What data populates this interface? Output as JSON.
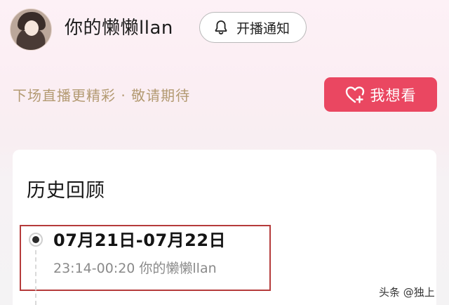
{
  "header": {
    "streamer_name": "你的懒懒llan",
    "notify_button_label": "开播通知"
  },
  "promo": {
    "subtitle": "下场直播更精彩 · 敬请期待",
    "want_button_label": "我想看"
  },
  "history": {
    "title": "历史回顾",
    "items": [
      {
        "date_range": "07月21日-07月22日",
        "time_range": "23:14-00:20 你的懒懒llan"
      }
    ]
  },
  "watermark": "头条 @独上",
  "colors": {
    "accent": "#ea4761",
    "subtitle": "#b39a72",
    "highlight_border": "#b53b3b"
  },
  "icons": {
    "notify": "bell-icon",
    "want": "heart-plus-icon",
    "avatar": "avatar-image"
  }
}
